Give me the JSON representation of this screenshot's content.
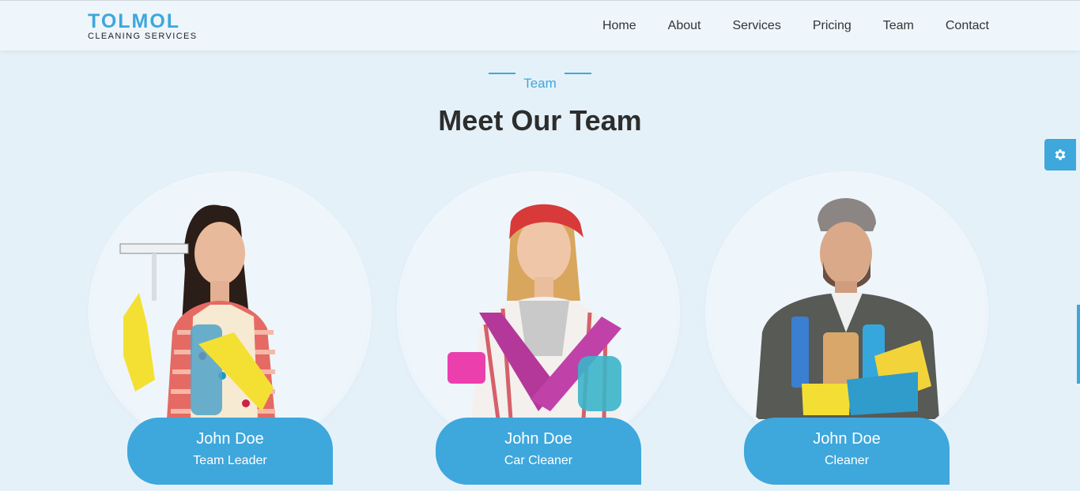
{
  "brand": {
    "name": "TOLMOL",
    "tagline": "CLEANING SERVICES"
  },
  "nav": {
    "items": [
      "Home",
      "About",
      "Services",
      "Pricing",
      "Team",
      "Contact"
    ]
  },
  "section": {
    "tag": "Team",
    "title": "Meet Our Team"
  },
  "team": [
    {
      "name": "John Doe",
      "role": "Team Leader"
    },
    {
      "name": "John Doe",
      "role": "Car Cleaner"
    },
    {
      "name": "John Doe",
      "role": "Cleaner"
    }
  ],
  "settings": {
    "icon": "gear-icon"
  },
  "colors": {
    "accent": "#3ea7dc",
    "background": "#e5f1f9",
    "title": "#2d2d2d"
  }
}
